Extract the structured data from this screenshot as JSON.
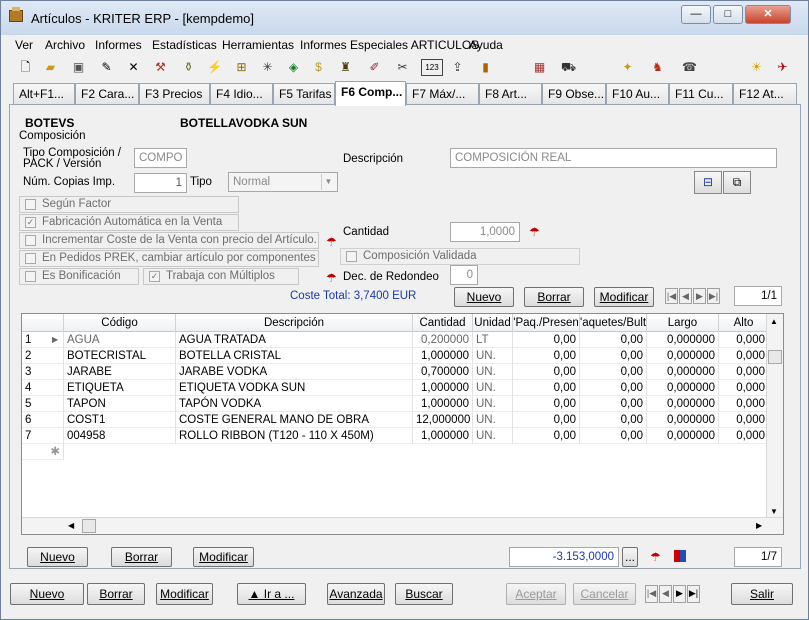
{
  "window": {
    "title": "Artículos - KRITER ERP - [kempdemo]",
    "minimize": "—",
    "maximize": "□",
    "close": "✕"
  },
  "menu": [
    "Ver",
    "Archivo",
    "Informes",
    "Estadísticas",
    "Herramientas",
    "Informes Especiales ARTICULOS",
    "Ayuda"
  ],
  "toolbar_icons": [
    "new-doc-icon",
    "open-folder-icon",
    "save-icon",
    "edit-icon",
    "delete-icon",
    "tools-icon",
    "component-icon",
    "wand-icon",
    "tree-icon",
    "snowflake-icon",
    "box-icon",
    "money-icon",
    "stamp-icon",
    "brush-icon",
    "tag-icon",
    "numbers-icon",
    "transfer-icon",
    "chart-icon",
    "calculator-icon",
    "cart-icon",
    "coins-icon",
    "bag-icon",
    "phone-icon",
    "lightbulb-icon",
    "help-icon"
  ],
  "tabs": [
    "Alt+F1...",
    "F2 Cara...",
    "F3 Precios",
    "F4 Idio...",
    "F5 Tarifas",
    "F6 Comp...",
    "F7 Máx/...",
    "F8 Art...",
    "F9 Obse...",
    "F10 Au...",
    "F11 Cu...",
    "F12 At..."
  ],
  "article": {
    "code": "BOTEVS",
    "name": "BOTELLAVODKA SUN"
  },
  "composition": {
    "group_label": "Composición",
    "type_label_line1": "Tipo Composición /",
    "type_label_line2": "PACK / Versión",
    "type_value": "COMPO",
    "description_label": "Descripción",
    "description_value": "COMPOSICIÓN REAL",
    "copies_label": "Núm. Copias Imp.",
    "copies_value": "1",
    "tipo_label": "Tipo",
    "tipo_value": "Normal",
    "checks": [
      {
        "label": "Según Factor",
        "checked": false
      },
      {
        "label": "Fabricación Automática en la Venta",
        "checked": true
      },
      {
        "label": "Incrementar Coste de la Venta con precio del Artículo.",
        "checked": false
      },
      {
        "label": "En Pedidos PREK, cambiar artículo por componentes",
        "checked": false
      },
      {
        "label": "Es Bonificación",
        "checked": false
      },
      {
        "label": "Trabaja con Múltiplos",
        "checked": true
      }
    ],
    "quantity_label": "Cantidad",
    "quantity_value": "1,0000",
    "validated_label": "Composición Validada",
    "rounding_label": "Dec. de Redondeo",
    "rounding_value": "0",
    "total_cost": "Coste Total: 3,7400 EUR",
    "nuevo": "Nuevo",
    "borrar": "Borrar",
    "modificar": "Modificar",
    "record_pos": "1/1"
  },
  "grid": {
    "columns": [
      "",
      "Código",
      "Descripción",
      "Cantidad",
      "Unidad",
      "'Paq./Presen",
      "'aquetes/Bult",
      "Largo",
      "Alto"
    ],
    "rows": [
      [
        "1",
        "AGUA",
        "AGUA TRATADA",
        "0,200000",
        "LT",
        "0,00",
        "0,00",
        "0,000000",
        "0,000"
      ],
      [
        "2",
        "BOTECRISTAL",
        "BOTELLA CRISTAL",
        "1,000000",
        "UN.",
        "0,00",
        "0,00",
        "0,000000",
        "0,000"
      ],
      [
        "3",
        "JARABE",
        "JARABE VODKA",
        "0,700000",
        "UN.",
        "0,00",
        "0,00",
        "0,000000",
        "0,000"
      ],
      [
        "4",
        "ETIQUETA",
        "ETIQUETA VODKA SUN",
        "1,000000",
        "UN.",
        "0,00",
        "0,00",
        "0,000000",
        "0,000"
      ],
      [
        "5",
        "TAPON",
        "TAPÓN VODKA",
        "1,000000",
        "UN.",
        "0,00",
        "0,00",
        "0,000000",
        "0,000"
      ],
      [
        "6",
        "COST1",
        "COSTE GENERAL MANO DE OBRA",
        "12,000000",
        "UN.",
        "0,00",
        "0,00",
        "0,000000",
        "0,000"
      ],
      [
        "7",
        "004958",
        "ROLLO RIBBON (T120 - 110 X 450M)",
        "1,000000",
        "UN.",
        "0,00",
        "0,00",
        "0,000000",
        "0,000"
      ]
    ],
    "new_row_marker": "✱"
  },
  "grid_actions": {
    "nuevo": "Nuevo",
    "borrar": "Borrar",
    "modificar": "Modificar",
    "total_value": "-3.153,0000",
    "ellipsis": "...",
    "record_pos": "1/7"
  },
  "footer": {
    "nuevo": "Nuevo",
    "borrar": "Borrar",
    "modificar": "Modificar",
    "ir_a": "▲ Ir a ...",
    "avanzada": "Avanzada",
    "buscar": "Buscar",
    "aceptar": "Aceptar",
    "cancelar": "Cancelar",
    "salir": "Salir"
  }
}
